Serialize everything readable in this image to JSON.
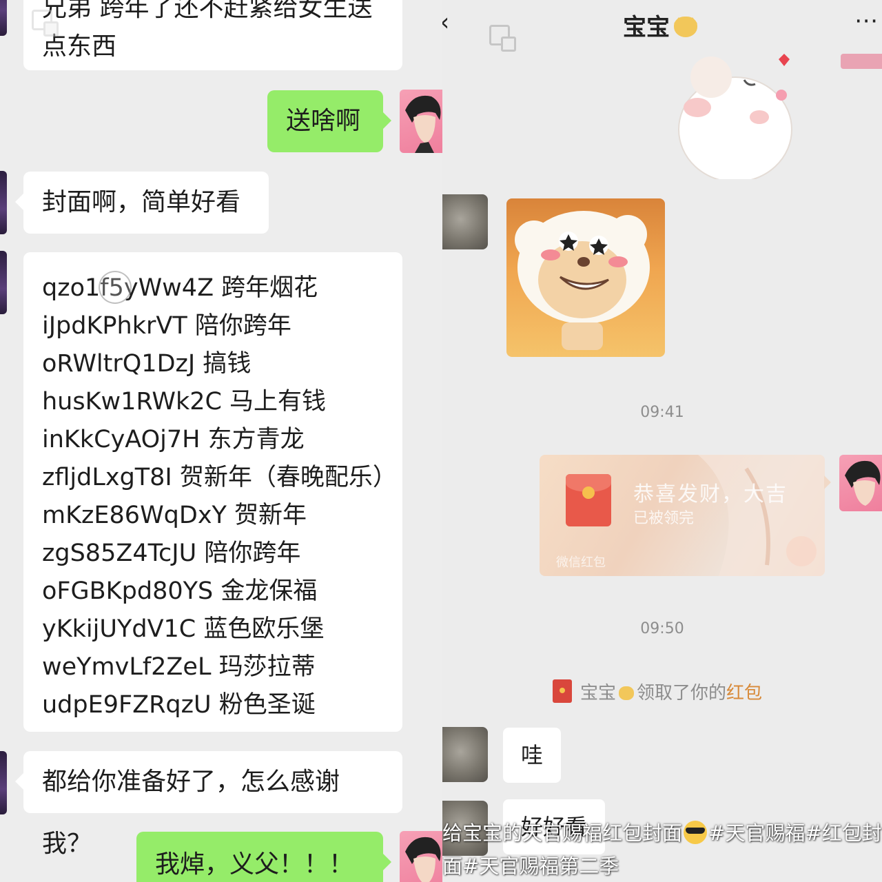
{
  "left_chat": {
    "messages": [
      {
        "side": "left",
        "text": "兄弟 跨年了还不赶紧给女生送"
      },
      {
        "side": "left",
        "text": "点东西"
      },
      {
        "side": "right",
        "text": "送啥啊"
      },
      {
        "side": "left",
        "text": "封面啊，简单好看"
      },
      {
        "side": "left",
        "text": "都给你准备好了，怎么感谢我？"
      },
      {
        "side": "right",
        "text": "我焯，义父！！！"
      }
    ],
    "codes": [
      "qzo1f5yWw4Z 跨年烟花",
      "iJpdKPhkrVT 陪你跨年",
      "oRWltrQ1DzJ 搞钱",
      "husKw1RWk2C 马上有钱",
      "inKkCyAOj7H 东方青龙",
      "zfljdLxgT8I 贺新年（春晚配乐）",
      "mKzE86WqDxY 贺新年",
      "zgS85Z4TcJU 陪你跨年",
      "oFGBKpd80YS 金龙保福",
      "yKkijUYdV1C 蓝色欧乐堡",
      "weYmvLf2ZeL 玛莎拉蒂",
      "udpE9FZRqzU 粉色圣诞"
    ]
  },
  "right_chat": {
    "header": {
      "back_icon": "chevron-left",
      "title": "宝宝",
      "title_emoji": "cat-face",
      "more_icon": "more-dots"
    },
    "timestamps": [
      "09:41",
      "09:50"
    ],
    "red_packet": {
      "title": "恭喜发财，大吉",
      "status": "已被领完",
      "footer": "微信红包"
    },
    "system_notice": {
      "name": "宝宝",
      "middle": "领取了你的",
      "highlight": "红包"
    },
    "messages": [
      {
        "side": "left",
        "text": "哇"
      },
      {
        "side": "left",
        "text": "好好看"
      }
    ]
  },
  "caption": {
    "line1_a": "给宝宝的天官赐福红包封面",
    "line1_b": "#天官赐福#红包封",
    "line2": "面#天官赐福第二季"
  },
  "colors": {
    "green_bubble": "#95ec69",
    "white_bubble": "#ffffff",
    "background": "#ededed",
    "red_packet_accent": "#e8594a"
  }
}
